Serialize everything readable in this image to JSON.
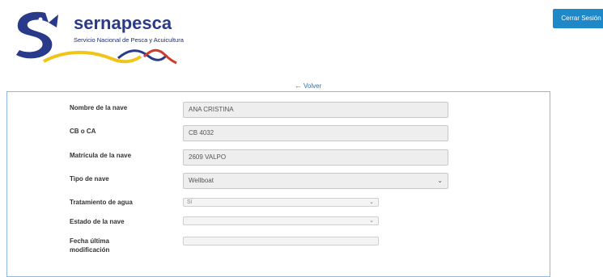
{
  "header": {
    "logo_title": "sernapesca",
    "logo_subtitle": "Servicio Nacional de Pesca y Acuicultura",
    "logout_label": "Cerrar Sesión"
  },
  "nav": {
    "back_label": "Volver"
  },
  "form": {
    "fields": [
      {
        "label": "Nombre de la nave",
        "value": "ANA CRISTINA"
      },
      {
        "label": "CB o CA",
        "value": "CB 4032"
      },
      {
        "label": "Matrícula de la nave",
        "value": "2609 VALPO"
      },
      {
        "label": "Tipo de nave",
        "value": "Wellboat"
      },
      {
        "label": "Tratamiento de agua",
        "value": "Sí"
      },
      {
        "label": "Estado de la nave",
        "value": ""
      },
      {
        "label": "Fecha última modificación",
        "label_line1": "Fecha última",
        "label_line2": "modificación",
        "value": ""
      }
    ]
  },
  "colors": {
    "brand_blue": "#2a3a8a",
    "button_blue": "#1e88c8",
    "panel_border": "#8fb6e0",
    "logo_yellow": "#f0c419",
    "logo_red": "#d03a2a"
  },
  "icons": {
    "logo": "sernapesca-fish-logo",
    "back": "arrow-left-icon",
    "dropdown": "chevron-down-icon"
  }
}
